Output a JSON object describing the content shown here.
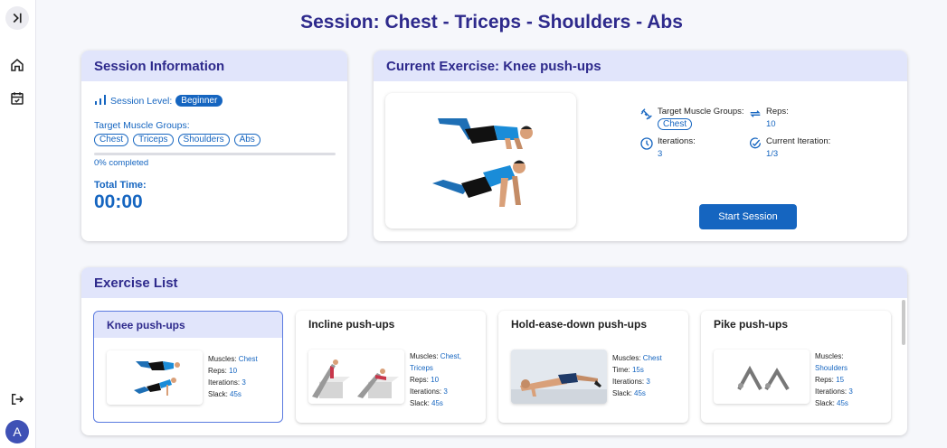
{
  "sidebar": {
    "toggle_icon": "sidebar-expand-icon",
    "items": [
      {
        "icon": "home-icon"
      },
      {
        "icon": "calendar-check-icon"
      }
    ],
    "logout_icon": "logout-icon",
    "avatar_initial": "A"
  },
  "page": {
    "title": "Session: Chest - Triceps - Shoulders - Abs"
  },
  "session_info": {
    "header": "Session Information",
    "level_label": "Session Level:",
    "level_value": "Beginner",
    "target_label": "Target Muscle Groups:",
    "muscles": [
      "Chest",
      "Triceps",
      "Shoulders",
      "Abs"
    ],
    "progress_percent": 0,
    "progress_text": "0% completed",
    "total_time_label": "Total Time:",
    "total_time_value": "00:00"
  },
  "current_exercise": {
    "header": "Current Exercise: Knee push-ups",
    "target_label": "Target Muscle Groups:",
    "target_value": "Chest",
    "reps_label": "Reps:",
    "reps_value": "10",
    "iterations_label": "Iterations:",
    "iterations_value": "3",
    "current_iteration_label": "Current Iteration:",
    "current_iteration_value": "1/3",
    "start_button": "Start Session"
  },
  "exercise_list": {
    "header": "Exercise List",
    "labels": {
      "muscles": "Muscles:",
      "reps": "Reps:",
      "time": "Time:",
      "iterations": "Iterations:",
      "slack": "Slack:"
    },
    "items": [
      {
        "name": "Knee push-ups",
        "muscles": "Chest",
        "reps": "10",
        "iterations": "3",
        "slack": "45s"
      },
      {
        "name": "Incline push-ups",
        "muscles_1": "Chest,",
        "muscles_2": "Triceps",
        "reps": "10",
        "iterations": "3",
        "slack": "45s"
      },
      {
        "name": "Hold-ease-down push-ups",
        "muscles": "Chest",
        "time": "15s",
        "iterations": "3",
        "slack": "45s"
      },
      {
        "name": "Pike push-ups",
        "muscles": "Shoulders",
        "reps": "15",
        "iterations": "3",
        "slack": "45s"
      }
    ]
  }
}
